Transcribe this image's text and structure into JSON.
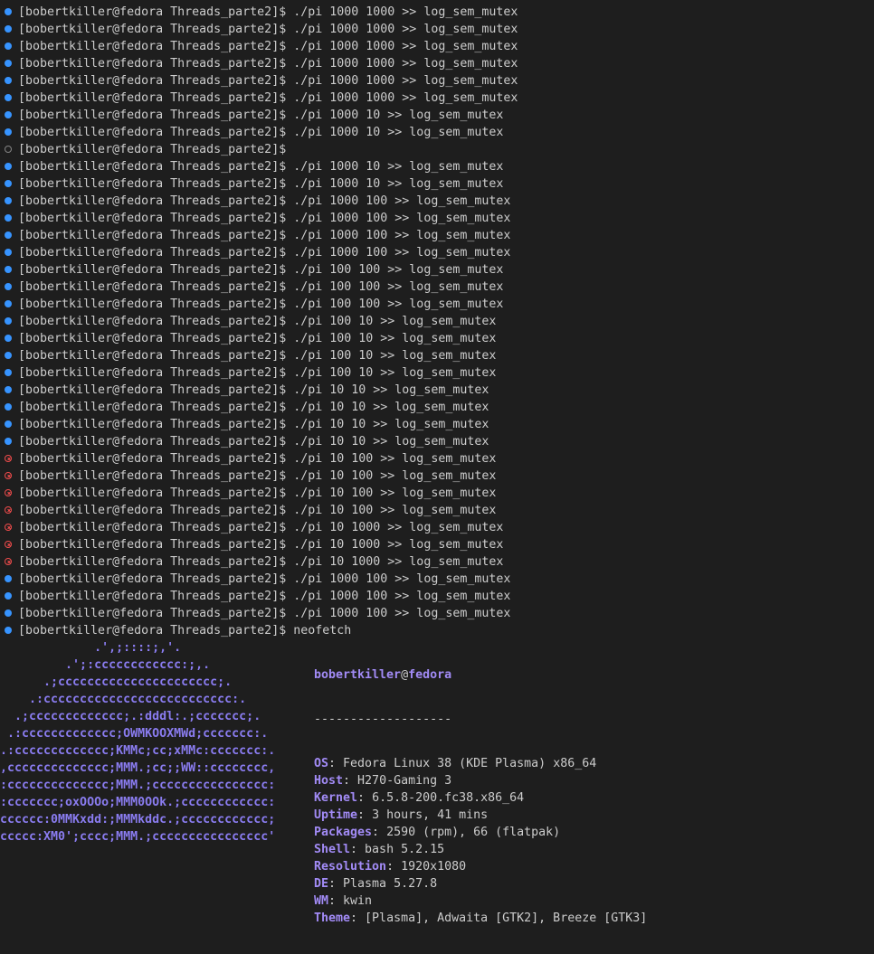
{
  "terminal": {
    "prompt": "[bobertkiller@fedora Threads_parte2]$ ",
    "history": [
      {
        "status": "success",
        "command": "./pi 1000 1000 >> log_sem_mutex"
      },
      {
        "status": "success",
        "command": "./pi 1000 1000 >> log_sem_mutex"
      },
      {
        "status": "success",
        "command": "./pi 1000 1000 >> log_sem_mutex"
      },
      {
        "status": "success",
        "command": "./pi 1000 1000 >> log_sem_mutex"
      },
      {
        "status": "success",
        "command": "./pi 1000 1000 >> log_sem_mutex"
      },
      {
        "status": "success",
        "command": "./pi 1000 1000 >> log_sem_mutex"
      },
      {
        "status": "success",
        "command": "./pi 1000 10 >> log_sem_mutex"
      },
      {
        "status": "success",
        "command": "./pi 1000 10 >> log_sem_mutex"
      },
      {
        "status": "default",
        "command": ""
      },
      {
        "status": "success",
        "command": "./pi 1000 10 >> log_sem_mutex"
      },
      {
        "status": "success",
        "command": "./pi 1000 10 >> log_sem_mutex"
      },
      {
        "status": "success",
        "command": "./pi 1000 100 >> log_sem_mutex"
      },
      {
        "status": "success",
        "command": "./pi 1000 100 >> log_sem_mutex"
      },
      {
        "status": "success",
        "command": "./pi 1000 100 >> log_sem_mutex"
      },
      {
        "status": "success",
        "command": "./pi 1000 100 >> log_sem_mutex"
      },
      {
        "status": "success",
        "command": "./pi 100 100 >> log_sem_mutex"
      },
      {
        "status": "success",
        "command": "./pi 100 100 >> log_sem_mutex"
      },
      {
        "status": "success",
        "command": "./pi 100 100 >> log_sem_mutex"
      },
      {
        "status": "success",
        "command": "./pi 100 10 >> log_sem_mutex"
      },
      {
        "status": "success",
        "command": "./pi 100 10 >> log_sem_mutex"
      },
      {
        "status": "success",
        "command": "./pi 100 10 >> log_sem_mutex"
      },
      {
        "status": "success",
        "command": "./pi 100 10 >> log_sem_mutex"
      },
      {
        "status": "success",
        "command": "./pi 10 10 >> log_sem_mutex"
      },
      {
        "status": "success",
        "command": "./pi 10 10 >> log_sem_mutex"
      },
      {
        "status": "success",
        "command": "./pi 10 10 >> log_sem_mutex"
      },
      {
        "status": "success",
        "command": "./pi 10 10 >> log_sem_mutex"
      },
      {
        "status": "error",
        "command": "./pi 10 100 >> log_sem_mutex"
      },
      {
        "status": "error",
        "command": "./pi 10 100 >> log_sem_mutex"
      },
      {
        "status": "error",
        "command": "./pi 10 100 >> log_sem_mutex"
      },
      {
        "status": "error",
        "command": "./pi 10 100 >> log_sem_mutex"
      },
      {
        "status": "error",
        "command": "./pi 10 1000 >> log_sem_mutex"
      },
      {
        "status": "error",
        "command": "./pi 10 1000 >> log_sem_mutex"
      },
      {
        "status": "error",
        "command": "./pi 10 1000 >> log_sem_mutex"
      },
      {
        "status": "success",
        "command": "./pi 1000 100 >> log_sem_mutex"
      },
      {
        "status": "success",
        "command": "./pi 1000 100 >> log_sem_mutex"
      },
      {
        "status": "success",
        "command": "./pi 1000 100 >> log_sem_mutex"
      },
      {
        "status": "success",
        "command": "neofetch"
      }
    ]
  },
  "neofetch": {
    "logo_lines": [
      "             .',;::::;,'.",
      "         .';:cccccccccccc:;,.",
      "      .;cccccccccccccccccccccc;.",
      "    .:cccccccccccccccccccccccccc:.",
      "  .;ccccccccccccc;.:dddl:.;ccccccc;.",
      " .:ccccccccccccc;OWMKOOXMWd;ccccccc:.",
      ".:ccccccccccccc;KMMc;cc;xMMc:ccccccc:.",
      ",cccccccccccccc;MMM.;cc;;WW::cccccccc,",
      ":cccccccccccccc;MMM.;cccccccccccccccc:",
      ":ccccccc;oxOOOo;MMM0OOk.;cccccccccccc:",
      "cccccc:0MMKxdd:;MMMkddc.;cccccccccccc;",
      "ccccc:XM0';cccc;MMM.;cccccccccccccccc'"
    ],
    "user": "bobertkiller",
    "at": "@",
    "host": "fedora",
    "separator": "-------------------",
    "fields": [
      {
        "key": "OS",
        "value": "Fedora Linux 38 (KDE Plasma) x86_64"
      },
      {
        "key": "Host",
        "value": "H270-Gaming 3"
      },
      {
        "key": "Kernel",
        "value": "6.5.8-200.fc38.x86_64"
      },
      {
        "key": "Uptime",
        "value": "3 hours, 41 mins"
      },
      {
        "key": "Packages",
        "value": "2590 (rpm), 66 (flatpak)"
      },
      {
        "key": "Shell",
        "value": "bash 5.2.15"
      },
      {
        "key": "Resolution",
        "value": "1920x1080"
      },
      {
        "key": "DE",
        "value": "Plasma 5.27.8"
      },
      {
        "key": "WM",
        "value": "kwin"
      },
      {
        "key": "Theme",
        "value": "[Plasma], Adwaita [GTK2], Breeze [GTK3]"
      }
    ]
  },
  "colors": {
    "background": "#1e1e1e",
    "text": "#cccccc",
    "success_marker": "#3794ff",
    "error_marker": "#f14c4c",
    "logo": "#8a7cf0",
    "key": "#a28bf6"
  }
}
